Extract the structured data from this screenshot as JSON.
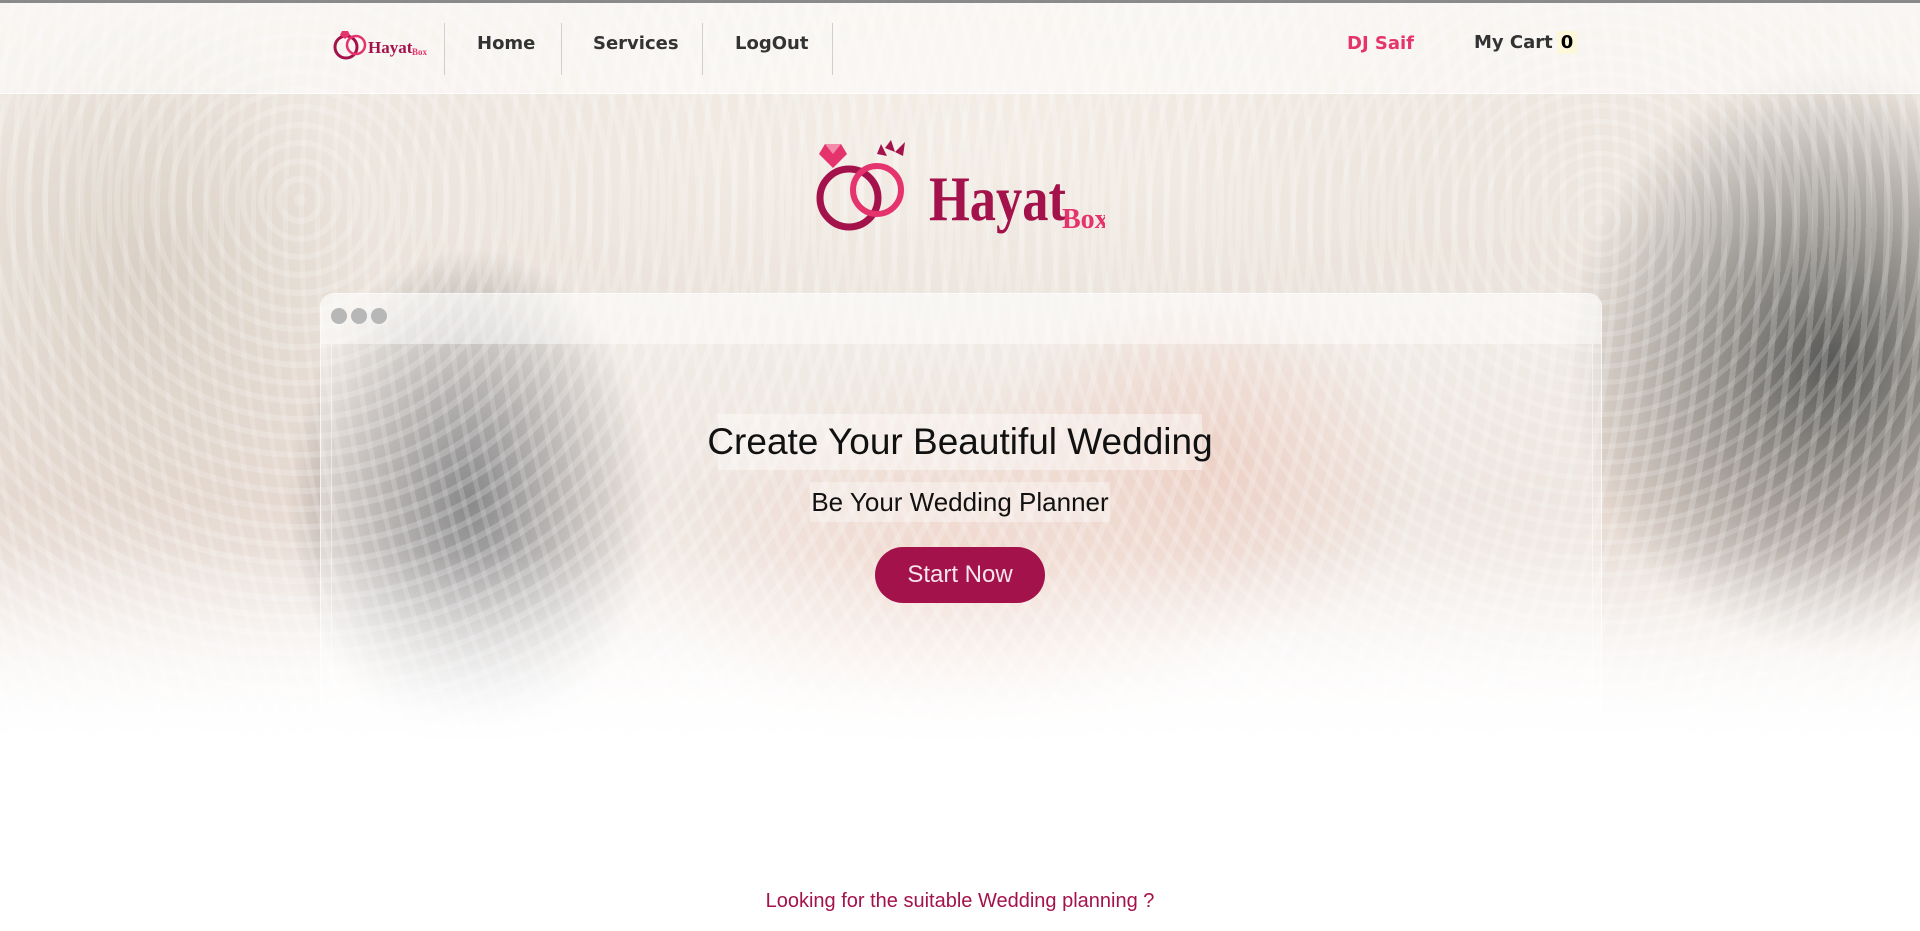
{
  "nav": {
    "logo_text": "Hayat Box",
    "links": [
      {
        "label": "Home"
      },
      {
        "label": "Services"
      },
      {
        "label": "LogOut"
      }
    ],
    "user_name": "DJ Saif",
    "cart_label": "My Cart",
    "cart_count": "0"
  },
  "brand": {
    "name": "Hayat",
    "suffix": "Box"
  },
  "hero": {
    "headline": "Create Your Beautiful Wedding",
    "subheadline": "Be Your Wedding Planner",
    "cta_label": "Start Now"
  },
  "section": {
    "tagline": "Looking for the suitable Wedding planning ?"
  },
  "colors": {
    "brand_primary": "#a3124a",
    "brand_pink": "#e5336d",
    "nav_text": "#333333"
  }
}
